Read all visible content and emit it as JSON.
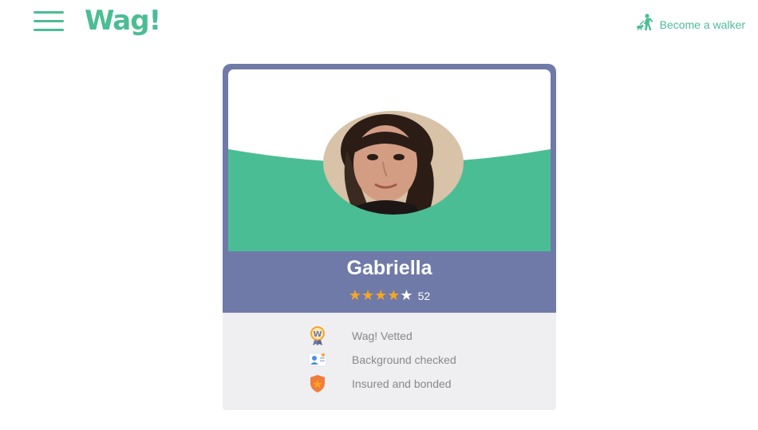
{
  "header": {
    "menu_icon": "hamburger-menu-icon",
    "logo_text": "Wag!",
    "become_walker_label": "Become a walker",
    "walker_icon": "dog-walker-icon"
  },
  "profile": {
    "name": "Gabriella",
    "rating": 4,
    "rating_max": 5,
    "review_count": "52",
    "badges": [
      {
        "icon": "wag-vetted-medal-icon",
        "label": "Wag! Vetted"
      },
      {
        "icon": "background-check-icon",
        "label": "Background checked"
      },
      {
        "icon": "insured-shield-icon",
        "label": "Insured and bonded"
      }
    ]
  },
  "colors": {
    "brand_green": "#4bbd94",
    "card_purple": "#6f7aa8",
    "star_gold": "#f5a623",
    "badge_bg": "#efeff2"
  }
}
